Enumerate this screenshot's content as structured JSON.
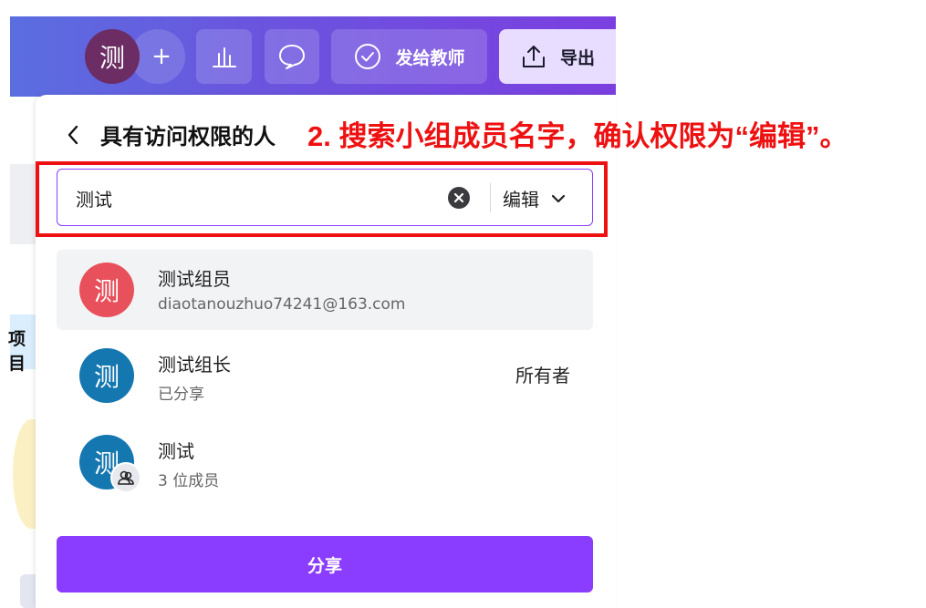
{
  "topbar": {
    "avatar_initial": "测",
    "plus_label": "+",
    "send_label": "发给教师",
    "export_label": "导出"
  },
  "background": {
    "partial_text": "项目"
  },
  "panel": {
    "title": "具有访问权限的人",
    "annotation": "2. 搜索小组成员名字，确认权限为“编辑”。",
    "search": {
      "value": "测试",
      "placeholder": "",
      "permission": "编辑"
    },
    "results": [
      {
        "initial": "测",
        "name": "测试组员",
        "sub": "diaotanouzhuo74241@163.com",
        "right": "",
        "avatar_color": "#e8505b",
        "selected": true
      },
      {
        "initial": "测",
        "name": "测试组长",
        "sub": "已分享",
        "right": "所有者",
        "avatar_color": "#1577b0",
        "selected": false
      },
      {
        "initial": "测",
        "name": "测试",
        "sub": "3 位成员",
        "right": "",
        "avatar_color": "#1577b0",
        "selected": false,
        "group": true
      }
    ],
    "share_label": "分享"
  },
  "colors": {
    "accent": "#8b3dff",
    "annotation": "#ee1111",
    "avatar_top": "#6b2d63"
  }
}
